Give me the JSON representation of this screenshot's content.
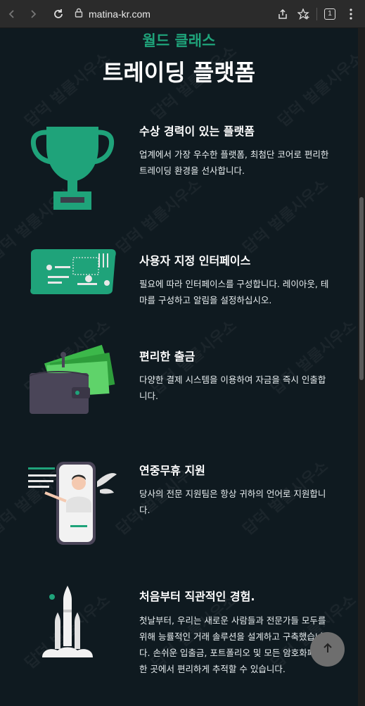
{
  "browser": {
    "url": "matina-kr.com",
    "tab_count": "1",
    "icons": [
      "back-icon",
      "forward-icon",
      "reload-icon",
      "site-info-icon",
      "share-icon",
      "bookmark-icon",
      "tabs-icon",
      "menu-icon"
    ]
  },
  "header": {
    "subtitle": "월드 클래스",
    "title": "트레이딩 플랫폼"
  },
  "features": [
    {
      "title": "수상 경력이 있는 플랫폼",
      "desc": "업계에서 가장 우수한 플랫폼, 최첨단 코어로 편리한 트레이딩 환경을 선사합니다.",
      "icon": "trophy-icon"
    },
    {
      "title": "사용자 지정 인터페이스",
      "desc": "필요에 따라 인터페이스를 구성합니다. 레이아웃, 테마를 구성하고 알림을 설정하십시오.",
      "icon": "interface-panel-icon"
    },
    {
      "title": "편리한 출금",
      "desc": "다양한 결제 시스템을 이용하여 자금을 즉시 인출합니다.",
      "icon": "wallet-money-icon"
    },
    {
      "title": "연중무휴 지원",
      "desc": "당사의 전문 지원팀은 항상 귀하의 언어로 지원합니다.",
      "icon": "support-phone-icon"
    },
    {
      "title": "처음부터 직관적인 경험.",
      "desc": "첫날부터, 우리는 새로운 사람들과 전문가들 모두를 위해 능률적인 거래 솔루션을 설계하고 구축했습니다. 손쉬운 입출금, 포트폴리오 및 모든 암호화폐를 한 곳에서 편리하게 추적할 수 있습니다.",
      "icon": "rocket-icon"
    }
  ],
  "watermark": "답덕 벌룰시우소",
  "colors": {
    "accent": "#1fa37a",
    "background": "#0f1a20",
    "text": "#ffffff"
  }
}
